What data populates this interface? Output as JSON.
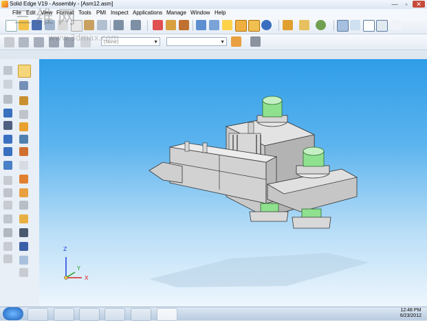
{
  "window": {
    "title": "Solid Edge V19 - Assembly - [Asm12.asm]",
    "controls": [
      "—",
      "▫",
      "✕"
    ]
  },
  "menu": [
    "File",
    "Edit",
    "View",
    "Format",
    "Tools",
    "PMI",
    "Inspect",
    "Applications",
    "Manage",
    "Window",
    "Help"
  ],
  "toolbar2": {
    "layer_combo_value": "(None)",
    "style_combo_value": ""
  },
  "watermark": {
    "text": "三维网",
    "url": "www.3dmax.com"
  },
  "triad": {
    "x_label": "X",
    "y_label": "Y",
    "z_label": "Z"
  },
  "taskbar": {
    "time": "12:48 PM",
    "date": "6/23/2012"
  },
  "colors": {
    "viewport_top": "#2f9de8",
    "viewport_bottom": "#eef6fd",
    "part_gray": "#c9c9c9",
    "bushing_green": "#8fe08f",
    "axis_x": "#e02020",
    "axis_y": "#20a020",
    "axis_z": "#2040e0"
  }
}
